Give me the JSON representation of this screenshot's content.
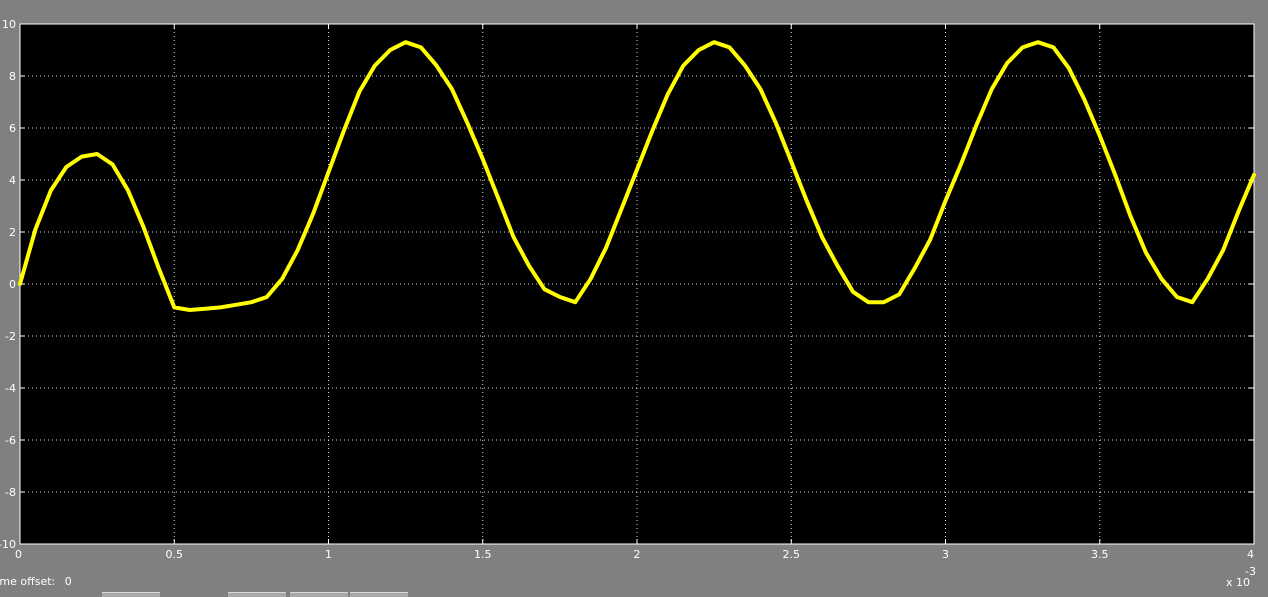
{
  "chart_data": {
    "type": "line",
    "background": "#000000",
    "frame_color": "#808080",
    "line_color": "#ffff00",
    "grid": true,
    "xlim": [
      0,
      0.004
    ],
    "ylim": [
      -10,
      10
    ],
    "x_ticks": [
      0,
      0.0005,
      0.001,
      0.0015,
      0.002,
      0.0025,
      0.003,
      0.0035,
      0.004
    ],
    "x_tick_labels": [
      "0",
      "0.5",
      "1",
      "1.5",
      "2",
      "2.5",
      "3",
      "3.5",
      "4"
    ],
    "y_ticks": [
      10,
      8,
      6,
      4,
      2,
      0,
      -2,
      -4,
      -6,
      -8,
      -10
    ],
    "y_tick_labels": [
      "10",
      "8",
      "6",
      "4",
      "2",
      "0",
      "-2",
      "-4",
      "-6",
      "-8",
      "-10"
    ],
    "x_exponent_base": "x 10",
    "x_exponent_power": "-3",
    "series": [
      {
        "color": "#ffff00",
        "x": [
          0,
          5e-05,
          0.0001,
          0.00015,
          0.0002,
          0.00025,
          0.0003,
          0.00035,
          0.0004,
          0.00045,
          0.0005,
          0.00055,
          0.0006,
          0.00065,
          0.0007,
          0.00075,
          0.0008,
          0.00085,
          0.0009,
          0.00095,
          0.001,
          0.00105,
          0.0011,
          0.00115,
          0.0012,
          0.00125,
          0.0013,
          0.00135,
          0.0014,
          0.00145,
          0.0015,
          0.00155,
          0.0016,
          0.00165,
          0.0017,
          0.00175,
          0.0018,
          0.00185,
          0.0019,
          0.00195,
          0.002,
          0.00205,
          0.0021,
          0.00215,
          0.0022,
          0.00225,
          0.0023,
          0.00235,
          0.0024,
          0.00245,
          0.0025,
          0.00255,
          0.0026,
          0.00265,
          0.0027,
          0.00275,
          0.0028,
          0.00285,
          0.0029,
          0.00295,
          0.003,
          0.00305,
          0.0031,
          0.00315,
          0.0032,
          0.00325,
          0.0033,
          0.00335,
          0.0034,
          0.00345,
          0.0035,
          0.00355,
          0.0036,
          0.00365,
          0.0037,
          0.00375,
          0.0038,
          0.00385,
          0.0039,
          0.00395,
          0.004
        ],
        "y": [
          0,
          2.1,
          3.6,
          4.5,
          4.9,
          5.0,
          4.6,
          3.6,
          2.2,
          0.6,
          -0.9,
          -1.0,
          -0.95,
          -0.9,
          -0.8,
          -0.7,
          -0.5,
          0.2,
          1.3,
          2.7,
          4.3,
          5.9,
          7.4,
          8.4,
          9.0,
          9.3,
          9.1,
          8.4,
          7.5,
          6.2,
          4.8,
          3.3,
          1.8,
          0.7,
          -0.2,
          -0.5,
          -0.7,
          0.2,
          1.4,
          2.9,
          4.4,
          5.9,
          7.3,
          8.4,
          9.0,
          9.3,
          9.1,
          8.4,
          7.5,
          6.2,
          4.7,
          3.2,
          1.8,
          0.7,
          -0.3,
          -0.7,
          -0.7,
          -0.4,
          0.6,
          1.7,
          3.2,
          4.6,
          6.1,
          7.5,
          8.5,
          9.1,
          9.3,
          9.1,
          8.3,
          7.1,
          5.7,
          4.2,
          2.6,
          1.2,
          0.2,
          -0.5,
          -0.7,
          0.2,
          1.3,
          2.8,
          4.2
        ]
      }
    ]
  },
  "status_bar": {
    "offset_label": "Time offset:",
    "offset_value": "0"
  }
}
